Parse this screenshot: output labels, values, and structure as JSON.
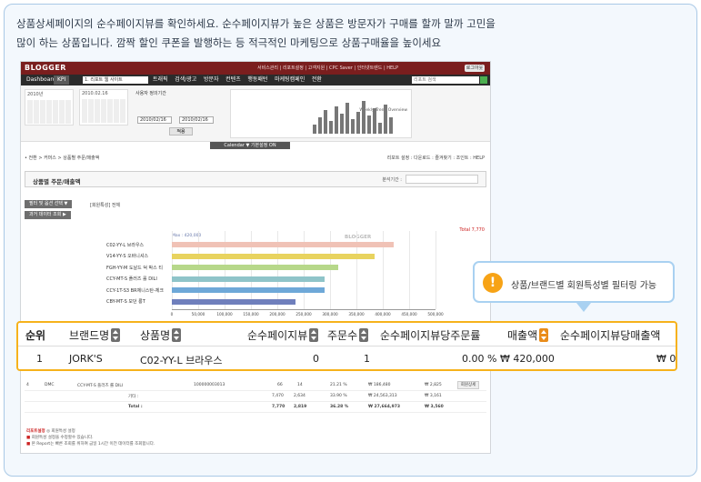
{
  "intro": {
    "line1": "상품상세페이지의 순수페이지뷰를 확인하세요. 순수페이지뷰가 높은 상품은 방문자가 구매를 할까 말까 고민을",
    "line2": "많이 하는 상품입니다. 깜짝 할인 쿠폰을 발행하는 등 적극적인 마케팅으로 상품구매율을 높이세요"
  },
  "app": {
    "logo": "BLOGGER",
    "top_links": "서비스관리 | 리포트설정 | 고객지원 | CPC Saver | 인터넷트렌드 | HELP",
    "top_button": "로그아웃",
    "nav": {
      "dashboard": "Dashboard",
      "kpi": "KPI",
      "site_select": "1. 리포트 웹 사이트",
      "items": [
        "트래픽",
        "검색/광고",
        "방문자",
        "컨텐츠",
        "행동패턴",
        "마케팅캠페인",
        "전환"
      ],
      "search_placeholder": "리포트 검색"
    },
    "period": {
      "year": "2010년",
      "month_value": "2010.02.16",
      "range_title": "사용자 정의기간",
      "start": "2010/02/16",
      "end": "2010/02/16",
      "apply": "적용",
      "trend_title": "Weekly Trend Overview"
    },
    "calendar_bar": "Calendar ▼ 기본설정 ON",
    "breadcrumb": "• 전환 > 커머스 > 상품별 주문/매출액",
    "crumb_right": "리포트 설정 : 다운로드 : 즐겨찾기 : 조인트 : HELP",
    "page_title": "상품별 주문/매출액",
    "filter_label": "분석기간 :",
    "btn_filter": "필터 및 옵션 선택 ▼",
    "btn_filter_tag": "[회원특성] 전체",
    "btn_past": "과거 데이터 조회 ▶"
  },
  "chart_data": {
    "type": "bar",
    "orientation": "horizontal",
    "legend": "Max : 420,000",
    "total": "Total 7,770",
    "logo": "BLOGGER",
    "categories": [
      "C02-YY-L 브라우스",
      "V14-YY-S 오바니셔스",
      "FGH-YY-M 도날드 덕 박스 티",
      "CCY-MT-S 플러즈 롤 DILI",
      "CCY-1T-S3 BR체니스탄-체크",
      "CBY-MT-S 모던 롱T"
    ],
    "values": [
      420000,
      385000,
      315000,
      290000,
      290000,
      235000
    ],
    "colors": [
      "#f0c2b6",
      "#e8d35f",
      "#b7d88a",
      "#8fc4c9",
      "#6ea8d8",
      "#6f7fbc"
    ],
    "ticks": [
      "0",
      "50,000",
      "100,000",
      "150,000",
      "200,000",
      "250,000",
      "300,000",
      "350,000",
      "400,000",
      "450,000",
      "500,000"
    ],
    "xlim": [
      0,
      500000
    ]
  },
  "lower_table": {
    "rows": [
      {
        "rank": "4",
        "brand": "DMC",
        "product": "CCY-MT-S 플러즈 롤 DILI",
        "pv": "100000003013",
        "orders": "66",
        "qty": "14",
        "rate": "21.21 %",
        "amount": "₩ 186,480",
        "per": "₩ 2,825",
        "btn": "회원상세"
      },
      {
        "rank": "",
        "brand": "",
        "product": "기타 :",
        "pv": "",
        "orders": "7,470",
        "qty": "2,634",
        "rate": "33.90 %",
        "amount": "₩ 24,563,313",
        "per": "₩ 3,161",
        "btn": ""
      },
      {
        "rank": "",
        "brand": "",
        "product": "Total :",
        "pv": "",
        "orders": "7,770",
        "qty": "2,819",
        "rate": "36.28 %",
        "amount": "₩ 27,664,973",
        "per": "₩ 3,560",
        "btn": ""
      }
    ]
  },
  "notes": {
    "title": "리포트설정",
    "line0": "회원특성 설정",
    "line1": "회원특성 설정을 수정할수 있습니다.",
    "line2": "본 Report는 빠른 조회를 위하여 금일 1시간 이전 데이터를 조회합니다."
  },
  "callout": {
    "icon": "!",
    "text": "상품/브랜드별 회원특성별 필터링 가능"
  },
  "zoom_table": {
    "headers": {
      "rank": "순위",
      "brand": "브랜드명",
      "product": "상품명",
      "pv": "순수페이지뷰",
      "orders": "주문수",
      "pv_per_order": "순수페이지뷰당주문률",
      "sales": "매출액",
      "pv_per_sales": "순수페이지뷰당매출액"
    },
    "row": {
      "rank": "1",
      "brand": "JORK'S",
      "product": "C02-YY-L 브라우스",
      "pv": "0",
      "orders": "1",
      "pv_per_order": "0.00 %",
      "sales": "₩ 420,000",
      "pv_per_sales": "₩ 0"
    }
  }
}
